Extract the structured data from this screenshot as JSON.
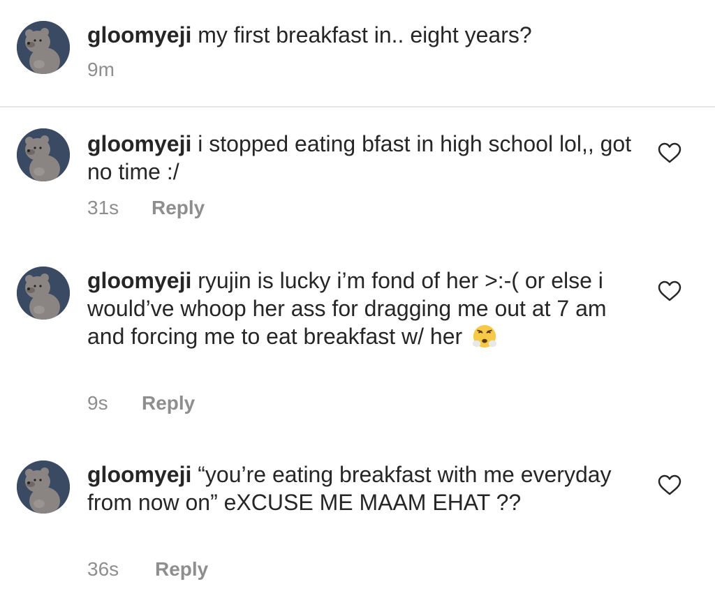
{
  "caption": {
    "username": "gloomyeji",
    "text": "my first breakfast in.. eight years?",
    "time": "9m"
  },
  "comments": [
    {
      "username": "gloomyeji",
      "text": "i stopped eating bfast in high school lol,, got no time :/",
      "time": "31s",
      "reply_label": "Reply"
    },
    {
      "username": "gloomyeji",
      "text": "ryujin is lucky i’m fond of her >:-( or else i would’ve whoop her ass for dragging me out at 7 am and forcing me to eat breakfast w/ her",
      "time": "9s",
      "reply_label": "Reply",
      "emoji": "face-with-steam-from-nose"
    },
    {
      "username": "gloomyeji",
      "text": "“you’re eating breakfast with me everyday from now on” eXCUSE ME MAAM EHAT ??",
      "time": "36s",
      "reply_label": "Reply"
    }
  ],
  "colors": {
    "text": "#262626",
    "meta": "#8e8e8e",
    "divider": "#e6e6e6",
    "avatar_bg": "#3b4a63",
    "bear": "#8a8482"
  }
}
